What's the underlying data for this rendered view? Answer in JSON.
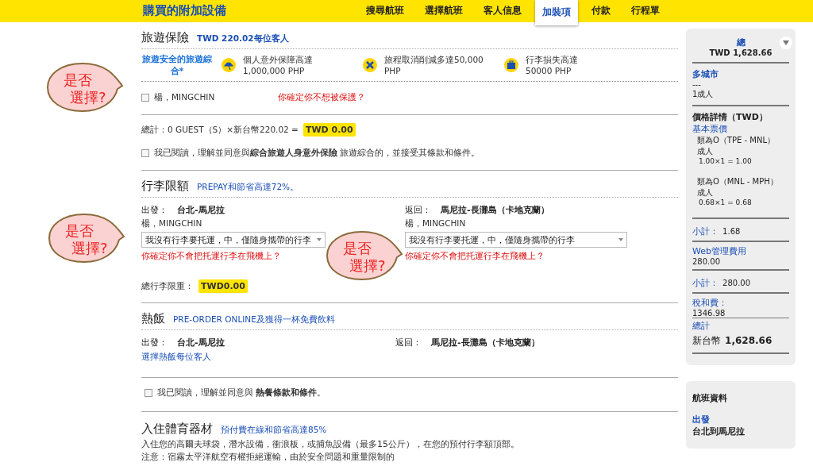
{
  "header": {
    "title": "購買的附加設備",
    "steps": [
      {
        "label": "搜尋航班",
        "selected": false
      },
      {
        "label": "選擇航班",
        "selected": false
      },
      {
        "label": "客人信息",
        "selected": false
      },
      {
        "label": "加裝項",
        "selected": true
      },
      {
        "label": "付款",
        "selected": false
      },
      {
        "label": "行程單",
        "selected": false
      }
    ]
  },
  "insurance": {
    "title": "旅遊保險",
    "price": "TWD 220.02每位客人",
    "plan": "旅遊安全的旅遊綜合*",
    "benefits": [
      {
        "kind": "umbrella",
        "line1": "個人意外保障高達",
        "line2": "1,000,000 PHP"
      },
      {
        "kind": "cross",
        "line1": "旅程取消削減多達50,000",
        "line2": "PHP"
      },
      {
        "kind": "suitcase",
        "line1": "行李損失高達",
        "line2": "50000 PHP"
      }
    ],
    "passenger": {
      "name": "楊，MINGCHIN",
      "checked": false,
      "warning": "你確定你不想被保護？"
    },
    "total_label": "總計：0  GUEST（S）×新台幣220.02 =",
    "total": "TWD 0.00",
    "terms": {
      "checked": false,
      "text": "我已閱讀，理解並同意與**綜合旅遊人身意外保險** 旅遊綜合的，並接受其條款和條件。"
    }
  },
  "baggage": {
    "title": "行李限額",
    "promo": "PREPAY和節省高達72%。",
    "legs": [
      {
        "direction": "出發：",
        "route": "台北-馬尼拉",
        "passenger": "楊，MINGCHIN",
        "option": "我沒有行李要托運，中，僅隨身攜帶的行李",
        "warning": "你確定你不會把托運行李在飛機上？"
      },
      {
        "direction": "返回：",
        "route": "馬尼拉-長灘島（卡地克蘭）",
        "passenger": "楊，MINGCHIN",
        "option": "我沒有行李要托運，中，僅隨身攜帶的行李",
        "warning": "你確定你不會把托運行李在飛機上？"
      }
    ],
    "total_label": "總行李限重：",
    "total": "TWD0.00"
  },
  "meals": {
    "title": "熱飯",
    "promo": "PRE-ORDER ONLINE及獲得一杯免費飲料",
    "legs": [
      {
        "direction": "出發：",
        "route": "台北-馬尼拉",
        "link": "選擇熱飯每位客人"
      },
      {
        "direction": "返回：",
        "route": "馬尼拉-長灘島（卡地克蘭）"
      }
    ],
    "terms": {
      "checked": false,
      "text": "我已閱讀，理解並同意與 **熱餐條款和條件**。"
    }
  },
  "sports": {
    "title": "入住體育器材",
    "promo": "預付費在線和節省高達85%",
    "lines": [
      "入住您的高爾夫球袋，潛水設備，衝浪板，或捕魚設備（最多15公斤），在您的預付行李額頂部。",
      "注意：宿霧太平洋航空有權拒絕運輸，由於安全問題和重量限制的"
    ]
  },
  "summary": {
    "total_label": "總",
    "total": "TWD 1,628.66",
    "trip_type": "多城市",
    "dashes": "---",
    "pax": "1成人",
    "price_title": "價格詳情（TWD）",
    "base_fare": "基本票價",
    "fares": [
      {
        "route": "類為O（TPE - MNL）",
        "pax": "成人",
        "calc": "1.00×1 = 1.00"
      },
      {
        "route": "類為O（MNL - MPH）",
        "pax": "成人",
        "calc": "0.68×1 = 0.68"
      }
    ],
    "subtotal1_label": "小計：",
    "subtotal1": "1.68",
    "fee_label": "Web管理費用",
    "fee": "280.00",
    "subtotal2_label": "小計：",
    "subtotal2": "280.00",
    "tax_label": "稅和費：",
    "tax": "1346.98",
    "grand_label": "總計",
    "grand_currency": "新台幣",
    "grand": "1,628.66"
  },
  "flight": {
    "title": "航班資料",
    "depart_label": "出發",
    "route": "台北到馬尼拉"
  },
  "annotations": [
    {
      "lines": [
        "是否",
        "選擇?"
      ]
    },
    {
      "lines": [
        "是否",
        "選擇?"
      ]
    },
    {
      "lines": [
        "是否",
        "選擇?"
      ]
    }
  ]
}
